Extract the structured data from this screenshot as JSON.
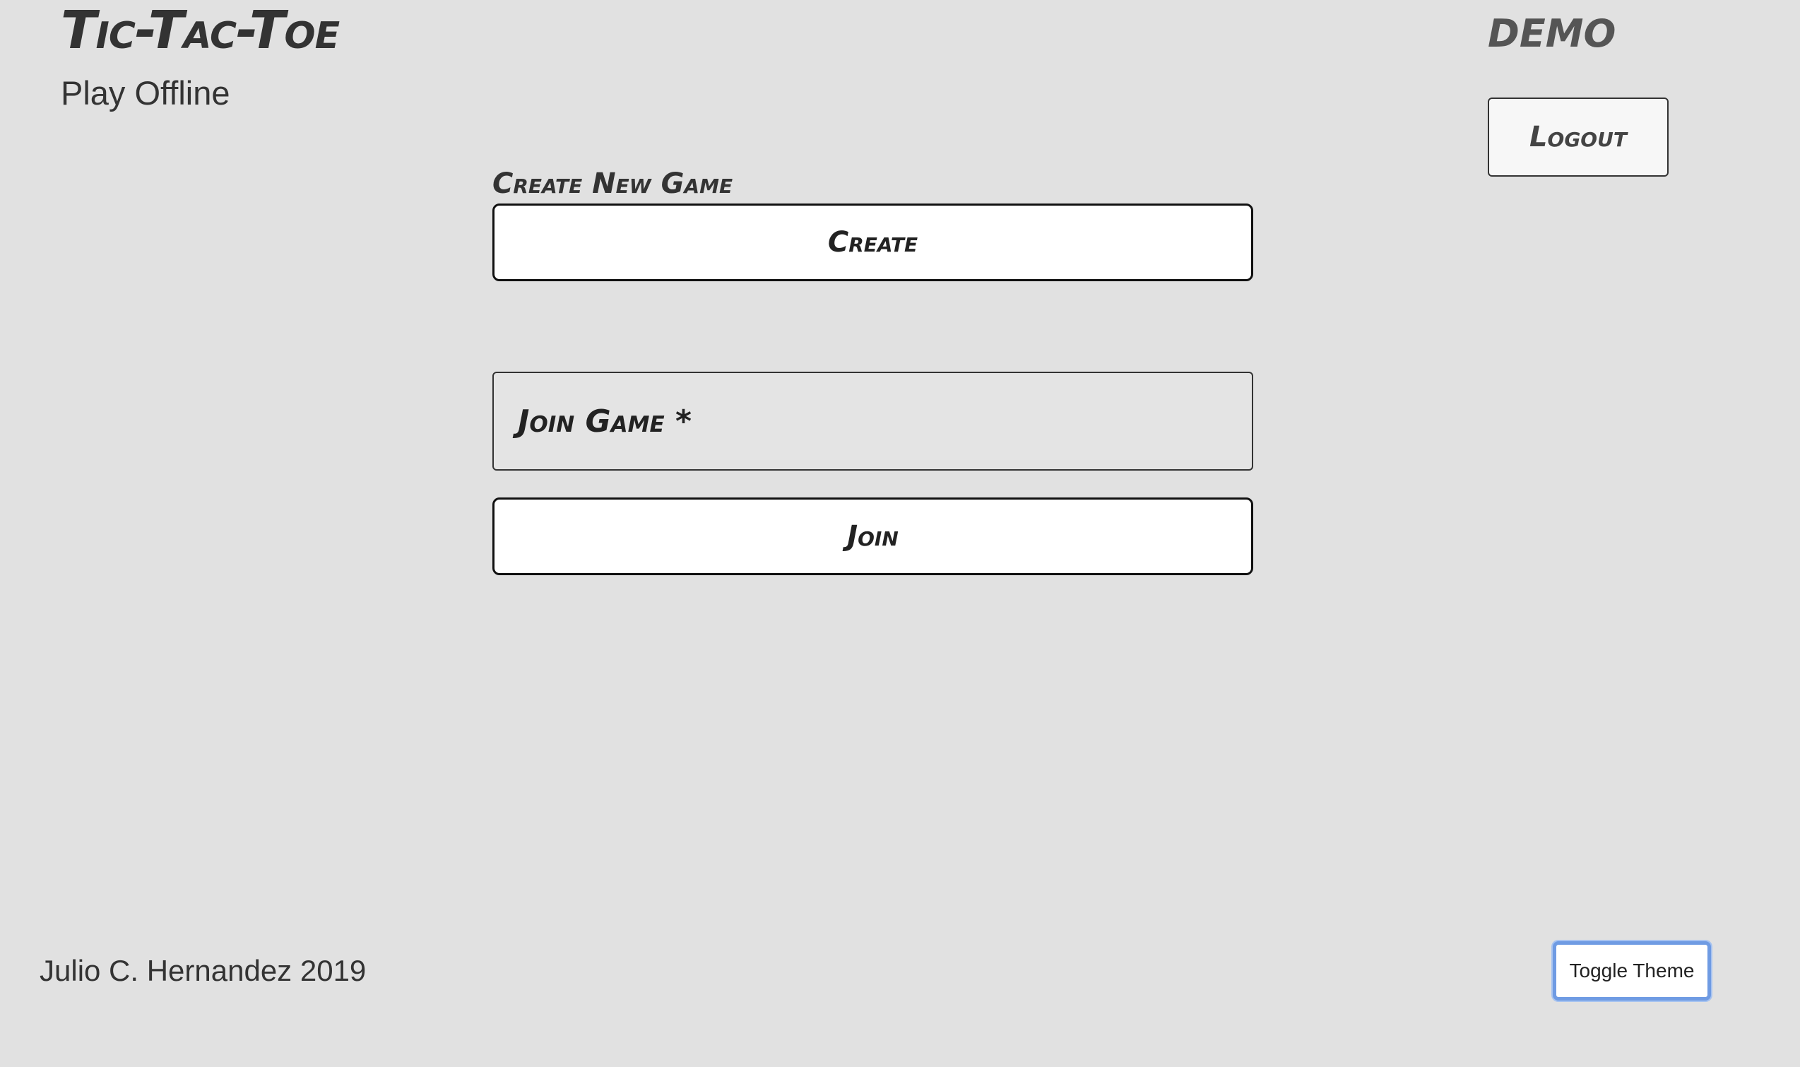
{
  "header": {
    "app_title": "Tic-Tac-Toe",
    "play_offline_link": "Play Offline",
    "username": "DEMO",
    "logout_label": "Logout"
  },
  "main": {
    "create_heading": "Create New Game",
    "create_button_label": "Create",
    "join_field_label": "Join Game *",
    "join_field_value": "",
    "join_button_label": "Join"
  },
  "footer": {
    "credit": "Julio C. Hernandez 2019",
    "toggle_theme_label": "Toggle Theme"
  },
  "colors": {
    "background": "#e1e1e1",
    "text": "#333333",
    "button_background": "#ffffff",
    "focus_ring": "#6f9be3"
  }
}
